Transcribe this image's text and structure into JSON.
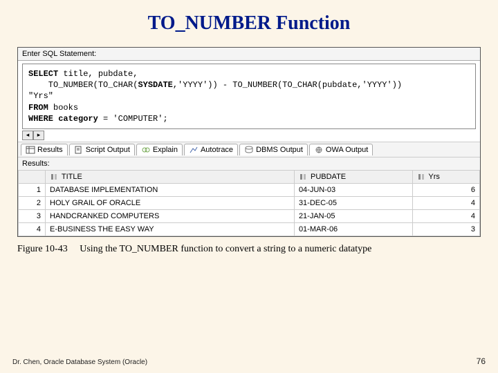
{
  "title": "TO_NUMBER Function",
  "prompt": "Enter SQL Statement:",
  "sql": {
    "line1_kw": "SELECT",
    "line1_rest": " title, pubdate,",
    "line2_a": "    TO_NUMBER(TO_CHAR(",
    "line2_kw": "SYSDATE",
    "line2_b": ",'YYYY')) - TO_NUMBER(TO_CHAR(pubdate,'YYYY'))",
    "line3": "\"Yrs\"",
    "line4_kw": "FROM",
    "line4_rest": " books",
    "line5_kw": "WHERE",
    "line5_mid": " ",
    "line5_kw2": "category",
    "line5_rest": " = 'COMPUTER';"
  },
  "tabs": [
    {
      "label": "Results"
    },
    {
      "label": "Script Output"
    },
    {
      "label": "Explain"
    },
    {
      "label": "Autotrace"
    },
    {
      "label": "DBMS Output"
    },
    {
      "label": "OWA Output"
    }
  ],
  "results_label": "Results:",
  "columns": [
    "",
    "TITLE",
    "PUBDATE",
    "Yrs"
  ],
  "rows": [
    {
      "n": "1",
      "title": "DATABASE IMPLEMENTATION",
      "pubdate": "04-JUN-03",
      "yrs": "6"
    },
    {
      "n": "2",
      "title": "HOLY GRAIL OF ORACLE",
      "pubdate": "31-DEC-05",
      "yrs": "4"
    },
    {
      "n": "3",
      "title": "HANDCRANKED COMPUTERS",
      "pubdate": "21-JAN-05",
      "yrs": "4"
    },
    {
      "n": "4",
      "title": "E-BUSINESS THE EASY WAY",
      "pubdate": "01-MAR-06",
      "yrs": "3"
    }
  ],
  "caption_figure": "Figure 10-43",
  "caption_text": "Using the TO_NUMBER function to convert a string to a numeric datatype",
  "footer_left": "Dr. Chen, Oracle Database System (Oracle)",
  "footer_right": "76"
}
